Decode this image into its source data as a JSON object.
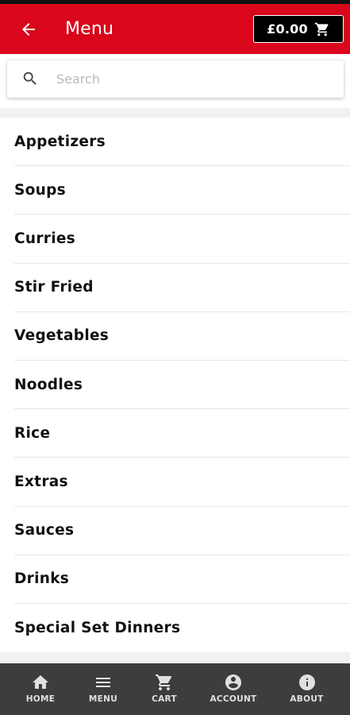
{
  "header": {
    "title": "Menu",
    "back_icon": "arrow-back-icon",
    "cart_total": "£0.00",
    "cart_icon": "shopping-cart-icon"
  },
  "search": {
    "placeholder": "Search",
    "value": "",
    "icon": "search-icon"
  },
  "categories": [
    {
      "label": "Appetizers"
    },
    {
      "label": "Soups"
    },
    {
      "label": "Curries"
    },
    {
      "label": "Stir Fried"
    },
    {
      "label": "Vegetables"
    },
    {
      "label": "Noodles"
    },
    {
      "label": "Rice"
    },
    {
      "label": "Extras"
    },
    {
      "label": "Sauces"
    },
    {
      "label": "Drinks"
    },
    {
      "label": "Special Set Dinners"
    }
  ],
  "bottom_nav": [
    {
      "label": "HOME",
      "icon": "home-icon"
    },
    {
      "label": "MENU",
      "icon": "menu-icon"
    },
    {
      "label": "CART",
      "icon": "cart-icon"
    },
    {
      "label": "ACCOUNT",
      "icon": "account-icon"
    },
    {
      "label": "ABOUT",
      "icon": "info-icon"
    }
  ],
  "colors": {
    "brand_red": "#d9061c",
    "cart_button": "#000000",
    "bottom_nav": "#3d3d3d"
  }
}
